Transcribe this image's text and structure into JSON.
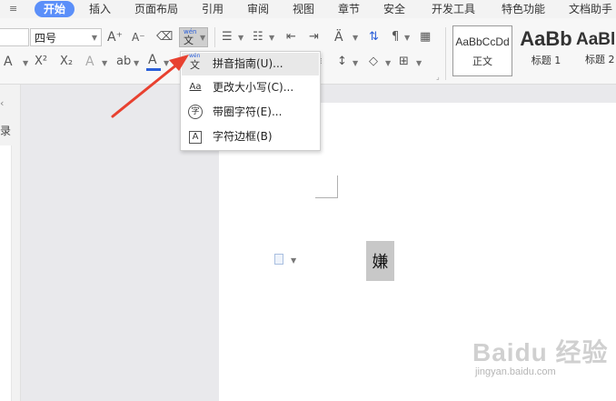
{
  "tabs": [
    {
      "label": "开始",
      "active": true
    },
    {
      "label": "插入"
    },
    {
      "label": "页面布局"
    },
    {
      "label": "引用"
    },
    {
      "label": "审阅"
    },
    {
      "label": "视图"
    },
    {
      "label": "章节"
    },
    {
      "label": "安全"
    },
    {
      "label": "开发工具"
    },
    {
      "label": "特色功能"
    },
    {
      "label": "文档助手"
    }
  ],
  "ribbon": {
    "font_size_value": "四号",
    "pinyin_icon_text": "wén",
    "pinyin_icon_char": "文",
    "styles": [
      {
        "sample": "AaBbCcDd",
        "label": "正文"
      },
      {
        "sample": "AaBb",
        "label": "标题 1"
      },
      {
        "sample": "AaBl",
        "label": "标题 2"
      }
    ]
  },
  "left_pane": {
    "label": "录"
  },
  "dropdown": {
    "items": [
      {
        "label": "拼音指南(U)...",
        "icon": "pinyin-icon",
        "icon_text": "文"
      },
      {
        "label": "更改大小写(C)...",
        "icon": "change-case-icon",
        "icon_text": "Aa"
      },
      {
        "label": "带圈字符(E)...",
        "icon": "enclosed-char-icon",
        "icon_text": "字"
      },
      {
        "label": "字符边框(B)",
        "icon": "char-border-icon",
        "icon_text": "A"
      }
    ]
  },
  "document": {
    "selected_char": "嫌"
  },
  "watermark": {
    "brand": "Baidu 经验",
    "url": "jingyan.baidu.com"
  },
  "colors": {
    "accent": "#5b8ff9",
    "arrow": "#e84130",
    "font_color_bar": "#2b5fd9",
    "highlight": "#c8c8c8"
  }
}
